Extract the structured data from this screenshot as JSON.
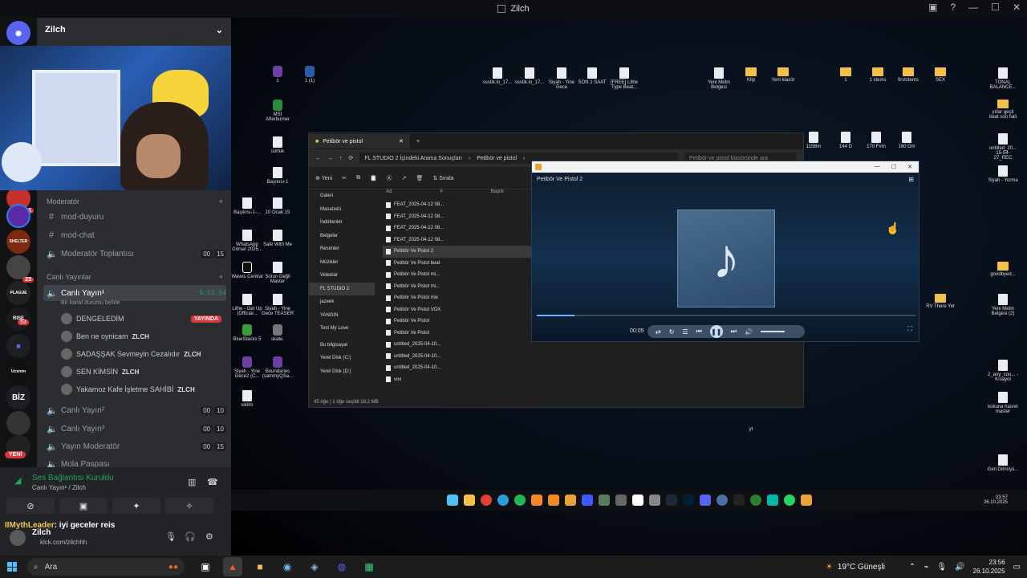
{
  "window": {
    "title": "Zilch"
  },
  "discord": {
    "server_name": "Zilch",
    "categories": [
      {
        "label": "Moderatör"
      },
      {
        "label": "Canlı Yayınlar"
      }
    ],
    "text_channels": [
      {
        "label": "mod-duyuru"
      },
      {
        "label": "mod-chat"
      }
    ],
    "voice_channels": [
      {
        "label": "Moderatör Toplantısı",
        "users": "00",
        "limit": "15"
      },
      {
        "label": "Canlı Yayın¹",
        "time": "5:53:54",
        "status": "Bir kanal durumu belirle"
      },
      {
        "label": "Canlı Yayın²",
        "users": "00",
        "limit": "10"
      },
      {
        "label": "Canlı Yayın³",
        "users": "00",
        "limit": "10"
      },
      {
        "label": "Yayın Moderatör",
        "users": "00",
        "limit": "15"
      },
      {
        "label": "Mola Paspası"
      }
    ],
    "members": [
      {
        "name": "DENGELEDİM",
        "tag": "",
        "live": "YAYINDA"
      },
      {
        "name": "Ben ne oynicam",
        "tag": "ZLCH"
      },
      {
        "name": "SADAŞŞAK Sevmeyin Cezalıdır",
        "tag": "ZLCH"
      },
      {
        "name": "SEN KİMSİN",
        "tag": "ZLCH"
      },
      {
        "name": "Yakamoz Kafe İşletme SAHİBİ",
        "tag": "ZLCH"
      }
    ],
    "guild_badges": {
      "g1": "1",
      "g2": "23",
      "g3": "53"
    },
    "guild_labels": {
      "shelter": "SHELTER",
      "plague": "PLAGUE",
      "rise": "RISE",
      "biz": "BİZ",
      "ucs": "Ucsmm",
      "yeni": "YENİ"
    },
    "voice_connected": {
      "title": "Ses Bağlantısı Kuruldu",
      "sub": "Canlı Yayın¹ / Zilch"
    },
    "user": {
      "name": "Zilch",
      "status": "kick.com/zilchhh"
    },
    "chat_overlay": {
      "who": "IIMythLeader",
      "msg": ": iyi geceler reis"
    }
  },
  "desktop_icons": [
    {
      "label": "1"
    },
    {
      "label": "1 (1)"
    },
    {
      "label": "MSI Afterburner"
    },
    {
      "label": "sürtuk"
    },
    {
      "label": "Başıkısı-1"
    },
    {
      "label": "Başıkısı-1-..."
    },
    {
      "label": "10 Ocak 15"
    },
    {
      "label": "WhatsApp Görsel 2025..."
    },
    {
      "label": "Safe With Me"
    },
    {
      "label": "Waves Central"
    },
    {
      "label": "Sorun Değil Master"
    },
    {
      "label": "Lithe - Get Up (Official..."
    },
    {
      "label": "Siyah - Yine Gece TEASER"
    },
    {
      "label": "BlueStacks 5"
    },
    {
      "label": "skate."
    },
    {
      "label": "Siyah - Yine Gece2 (C..."
    },
    {
      "label": "Boundaries (sammyQSa..."
    },
    {
      "label": "siktim"
    },
    {
      "label": "ssstik.io_17..."
    },
    {
      "label": "ssstik.io_17..."
    },
    {
      "label": "Siyah - Yine Gece"
    },
    {
      "label": "SON 1 SAAT"
    },
    {
      "label": "[FREE] Lithe Type Beat..."
    },
    {
      "label": "Yeni Metin Belgesi"
    },
    {
      "label": "Klip"
    },
    {
      "label": "Yeni klasör"
    },
    {
      "label": "1"
    },
    {
      "label": "1 stems"
    },
    {
      "label": "firststems"
    },
    {
      "label": "SEX"
    },
    {
      "label": "TONAL BALANCE..."
    },
    {
      "label": "yıllar geçti beat son hali"
    },
    {
      "label": "untitled_20... 15-54-27_REC"
    },
    {
      "label": "Siyah - Yorma"
    },
    {
      "label": "115Bm"
    },
    {
      "label": "144 D"
    },
    {
      "label": "170 F#m"
    },
    {
      "label": "160 Dm"
    },
    {
      "label": "goodbyed..."
    },
    {
      "label": "RV There Yet"
    },
    {
      "label": "Yeni Metin Belgesi (2)"
    },
    {
      "label": "2_any_cou... - Kısayol"
    },
    {
      "label": "kokuna hasret master"
    },
    {
      "label": "yt"
    },
    {
      "label": "Geri Dönüşü..."
    }
  ],
  "explorer": {
    "tab": "Petibör ve pistol",
    "path1": "FL STUDIO 2 İçindeki Arama Sonuçları",
    "path2": "Petibör ve pistol",
    "search": "Petibör ve pistol klasöründe ara",
    "toolbar": {
      "new": "Yeni",
      "sort": "Sırala"
    },
    "sidebar": [
      "Galeri",
      "Masaüstü",
      "İndirilenler",
      "Belgeler",
      "Resimler",
      "Müzikler",
      "Videolar",
      "FL STUDIO 2",
      "jazeek",
      "YANGIN",
      "Test My Love",
      "Bu bilgisayar",
      "Yerel Disk (C:)",
      "Yerel Disk (D:)"
    ],
    "columns": {
      "name": "Ad",
      "num": "#",
      "title": "Başlık"
    },
    "files": [
      "FEAT_2025-04-12 08...",
      "FEAT_2025-04-12 08...",
      "FEAT_2025-04-12 08...",
      "FEAT_2025-04-12 08...",
      "Petibör Ve Pistol 2",
      "Petibör Ve Pistol beat",
      "Petibör Ve Pistol mi...",
      "Petibör Ve Pistol mi...",
      "Petibör Ve Pistol mix",
      "Petibör Ve Pistol VOX",
      "Petibör Ve Pistol",
      "Petibör Ve Pistol",
      "untitled_2025-04-10...",
      "untitled_2025-04-10...",
      "untitled_2025-04-10...",
      "vox"
    ],
    "status": "45 öğe  |  1 öğe seçildi 18,2 MB"
  },
  "player": {
    "song": "Petibör Ve Pistol 2",
    "elapsed": "00:05",
    "progress": 0.1
  },
  "taskbar": {
    "search": "Ara",
    "weather": "19°C  Güneşli",
    "time": "23:56",
    "date": "26.10.2025",
    "inner_time": "23:57",
    "inner_date": "26.10.2025"
  },
  "colors": {
    "discord_green": "#23a55a",
    "live_red": "#da373c",
    "folder": "#f3c14b"
  }
}
